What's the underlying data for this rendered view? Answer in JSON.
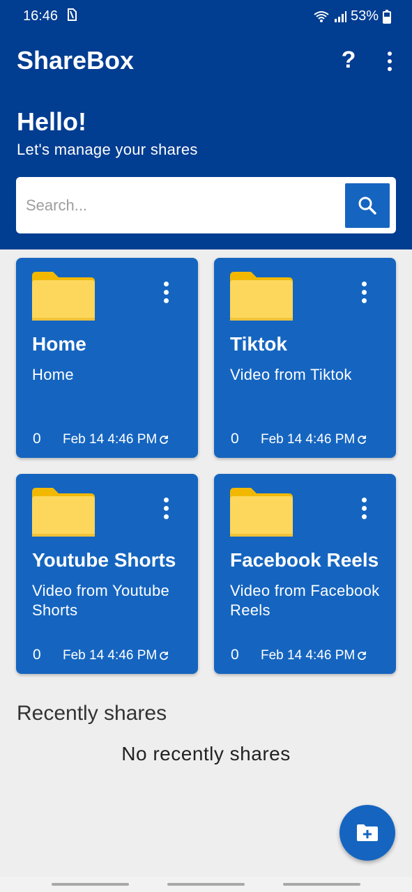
{
  "status_bar": {
    "time": "16:46",
    "battery": "53%"
  },
  "app_bar": {
    "title": "ShareBox",
    "help_label": "?"
  },
  "hero": {
    "greeting": "Hello!",
    "subtitle": "Let's manage your shares"
  },
  "search": {
    "placeholder": "Search...",
    "value": ""
  },
  "folders": [
    {
      "title": "Home",
      "description": "Home",
      "count": "0",
      "date": "Feb 14 4:46 PM"
    },
    {
      "title": "Tiktok",
      "description": "Video from Tiktok",
      "count": "0",
      "date": "Feb 14 4:46 PM"
    },
    {
      "title": "Youtube Shorts",
      "description": "Video from Youtube Shorts",
      "count": "0",
      "date": "Feb 14 4:46 PM"
    },
    {
      "title": "Facebook Reels",
      "description": "Video from Facebook Reels",
      "count": "0",
      "date": "Feb 14 4:46 PM"
    }
  ],
  "recent": {
    "title": "Recently shares",
    "empty_text": "No recently shares"
  },
  "colors": {
    "header": "#013d91",
    "card": "#1565c0",
    "background": "#eeeeee"
  },
  "icons": {
    "search": "search-icon",
    "folder": "folder-icon",
    "more": "more-vertical-icon",
    "sync": "sync-icon",
    "add_folder": "add-folder-icon"
  }
}
